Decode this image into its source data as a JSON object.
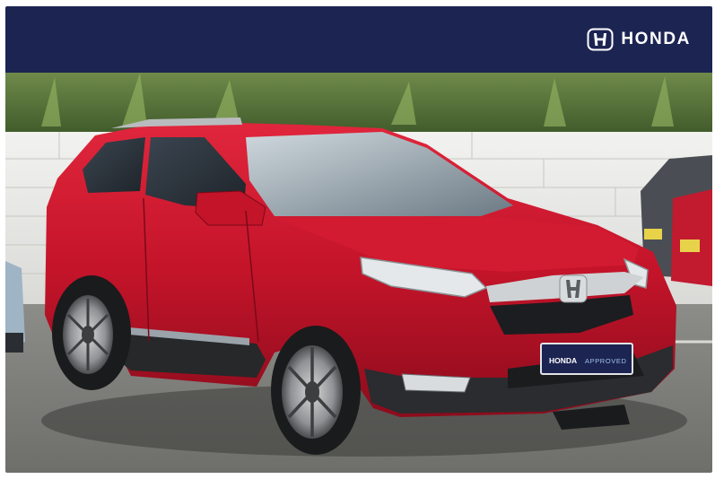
{
  "header": {
    "brand_name": "HONDA",
    "logo_icon": "honda-h-logo-icon",
    "background_color": "#1c2452",
    "text_color": "#ffffff"
  },
  "photo": {
    "plate": {
      "brand": "HONDA",
      "label": "APPROVED"
    },
    "car_color": "#c4142a"
  }
}
